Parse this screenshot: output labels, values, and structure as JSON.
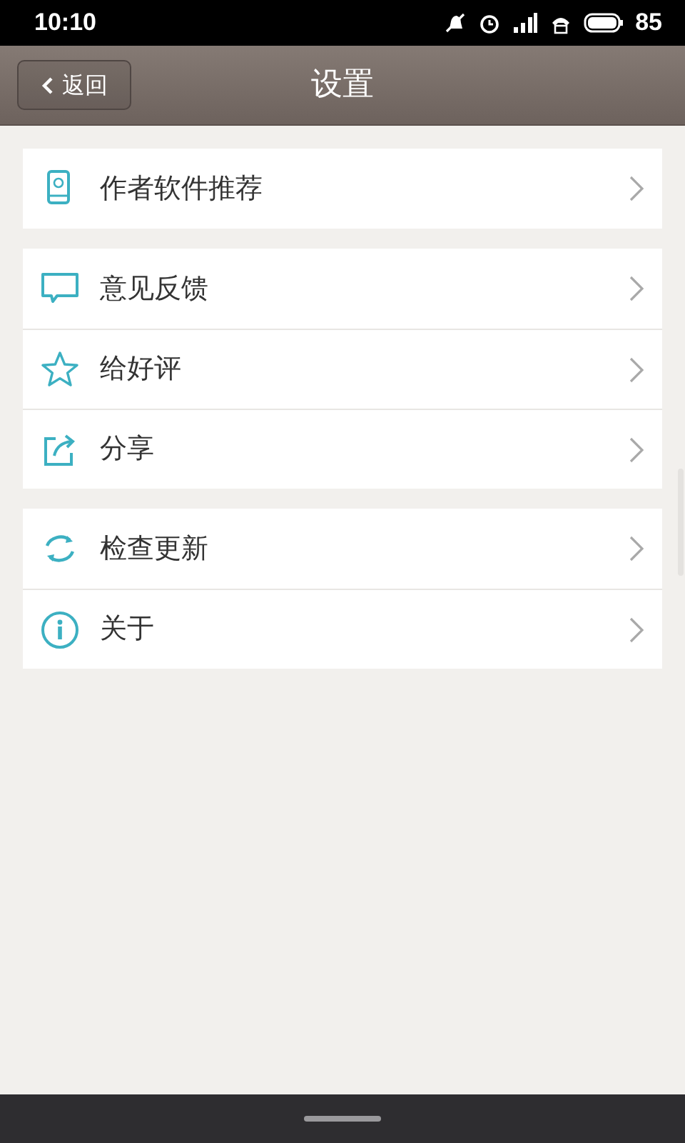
{
  "status_bar": {
    "time": "10:10",
    "battery": "85"
  },
  "header": {
    "back_button": "返回",
    "title": "设置"
  },
  "groups": [
    {
      "items": [
        {
          "label": "作者软件推荐"
        }
      ]
    },
    {
      "items": [
        {
          "label": "意见反馈"
        },
        {
          "label": "给好评"
        },
        {
          "label": "分享"
        }
      ]
    },
    {
      "items": [
        {
          "label": "检查更新"
        },
        {
          "label": "关于"
        }
      ]
    }
  ]
}
